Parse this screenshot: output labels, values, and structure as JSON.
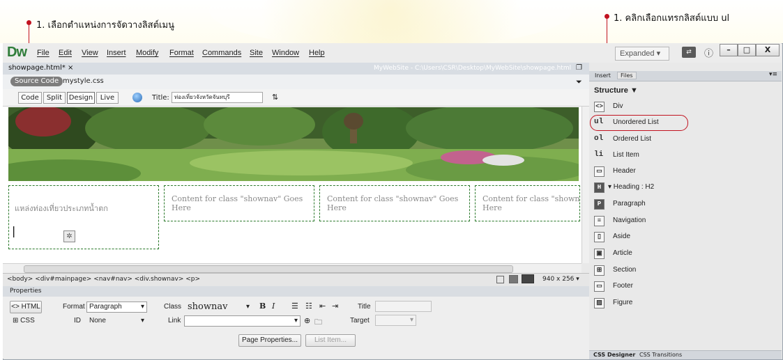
{
  "annotations": {
    "left": "1. เลือกตำแหน่งการจัดวางลิสต์เมนู",
    "right": "1. คลิกเลือกแทรกลิสต์แบบ ul"
  },
  "app": {
    "logo": "Dw",
    "menu": [
      "File",
      "Edit",
      "View",
      "Insert",
      "Modify",
      "Format",
      "Commands",
      "Site",
      "Window",
      "Help"
    ],
    "workspace": "Expanded",
    "workspace_arrow": "▾",
    "btn_min": "–",
    "btn_max": "□",
    "btn_close": "X",
    "sync_icon_label": "⇄",
    "info_icon_label": "ⓘ"
  },
  "document": {
    "tab": "showpage.html*",
    "tab_close": "×",
    "path": "MyWebSite - C:\\Users\\CSR\\Desktop\\MyWebSite\\showpage.html",
    "source_code": "Source Code",
    "related_file": "mystyle.css",
    "views": [
      "Code",
      "Split",
      "Design",
      "Live"
    ],
    "title_label": "Title:",
    "title_value": "ท่องเที่ยวจังหวัดจันทบุรี"
  },
  "design": {
    "box1_text": "แหล่งท่องเที่ยวประเภทน้ำตก",
    "cursor": "|",
    "box_placeholder": "Content for class \"shownav\" Goes Here",
    "box4_placeholder": "Content for class \"shownav"
  },
  "status": {
    "tag_path": "<body> <div#mainpage> <nav#nav> <div.shownav> <p>",
    "size": "940 x 256 ▾"
  },
  "properties": {
    "title": "Properties",
    "html_btn": "<> HTML",
    "css_btn": "CSS",
    "format_label": "Format",
    "format_value": "Paragraph",
    "id_label": "ID",
    "id_value": "None",
    "class_label": "Class",
    "class_value": "shownav",
    "link_label": "Link",
    "bold": "B",
    "italic": "I",
    "title_field_label": "Title",
    "target_label": "Target",
    "page_properties": "Page Properties...",
    "list_item": "List Item..."
  },
  "panel": {
    "tabs": [
      "Insert",
      "Files"
    ],
    "category": "Structure",
    "category_arrow": "▼",
    "items": [
      {
        "icon": "<>",
        "label": "Div"
      },
      {
        "icon": "ul",
        "label": "Unordered List"
      },
      {
        "icon": "ol",
        "label": "Ordered List"
      },
      {
        "icon": "li",
        "label": "List Item"
      },
      {
        "icon": "▭",
        "label": "Header"
      },
      {
        "icon": "H",
        "label": "▾ Heading : H2"
      },
      {
        "icon": "P",
        "label": "Paragraph"
      },
      {
        "icon": "≡",
        "label": "Navigation"
      },
      {
        "icon": "▯",
        "label": "Aside"
      },
      {
        "icon": "▣",
        "label": "Article"
      },
      {
        "icon": "⊞",
        "label": "Section"
      },
      {
        "icon": "▭",
        "label": "Footer"
      },
      {
        "icon": "▨",
        "label": "Figure"
      }
    ],
    "bottom_tabs": [
      "CSS Designer",
      "CSS Transitions"
    ]
  },
  "colors": {
    "accent_red": "#c1121f",
    "dw_green": "#2f7d3a",
    "dashed_green": "#2c7a2c"
  }
}
